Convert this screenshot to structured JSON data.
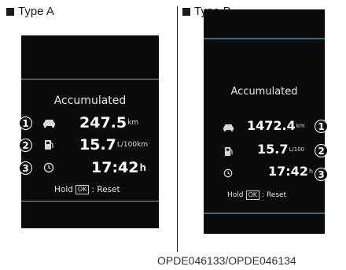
{
  "type_a": {
    "label": "Type A",
    "heading": "Accumulated",
    "distance": {
      "value": "247.5",
      "unit": "km",
      "callout": "1"
    },
    "fuel": {
      "value": "15.7",
      "unit": "L/100km",
      "callout": "2"
    },
    "time": {
      "value": "17:42",
      "unit": "h",
      "callout": "3"
    },
    "hold": {
      "prefix": "Hold",
      "key": "OK",
      "suffix": ": Reset"
    }
  },
  "type_b": {
    "label": "Type B",
    "heading": "Accumulated",
    "distance": {
      "value": "1472.4",
      "unit": "km",
      "callout": "1"
    },
    "fuel": {
      "value": "15.7",
      "unit": "L/100",
      "callout": "2"
    },
    "time": {
      "value": "17:42",
      "unit": "h",
      "callout": "3"
    },
    "hold": {
      "prefix": "Hold",
      "key": "OK",
      "suffix": ": Reset"
    }
  },
  "figure_code": "OPDE046133/OPDE046134",
  "icons": {
    "distance": "car-icon",
    "fuel": "fuel-pump-icon",
    "time": "clock-icon"
  },
  "colors": {
    "screen": "#0a0a0a",
    "accent_b": "#2d6f8c"
  }
}
